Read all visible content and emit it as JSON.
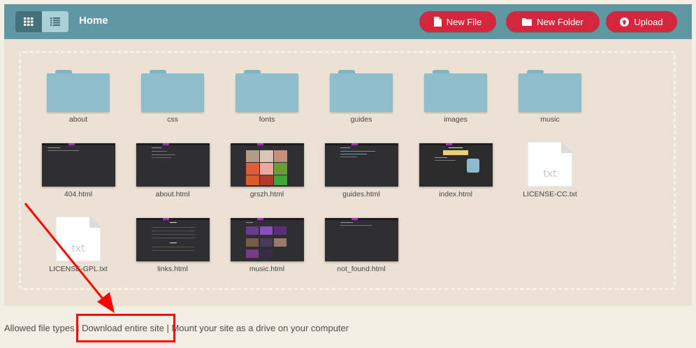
{
  "header": {
    "title": "Home",
    "buttons": {
      "new_file": "New File",
      "new_folder": "New Folder",
      "upload": "Upload"
    }
  },
  "folders": [
    {
      "name": "about"
    },
    {
      "name": "css"
    },
    {
      "name": "fonts"
    },
    {
      "name": "guides"
    },
    {
      "name": "images"
    },
    {
      "name": "music"
    }
  ],
  "files": [
    {
      "name": "404.html"
    },
    {
      "name": "about.html"
    },
    {
      "name": "grszh.html"
    },
    {
      "name": "guides.html"
    },
    {
      "name": "index.html"
    },
    {
      "name": "LICENSE-CC.txt",
      "icon": "txt"
    },
    {
      "name": "LICENSE-GPL.txt",
      "icon": "txt"
    },
    {
      "name": "links.html"
    },
    {
      "name": "music.html"
    },
    {
      "name": "not_found.html"
    }
  ],
  "footer": {
    "allowed": "Allowed file types",
    "sep1": " | ",
    "download": "Download entire site",
    "sep2": " | ",
    "mount": "Mount your site as a drive on your computer"
  },
  "colors": {
    "header": "#5f97a3",
    "accent": "#d4273e",
    "highlight": "#ff0000"
  }
}
